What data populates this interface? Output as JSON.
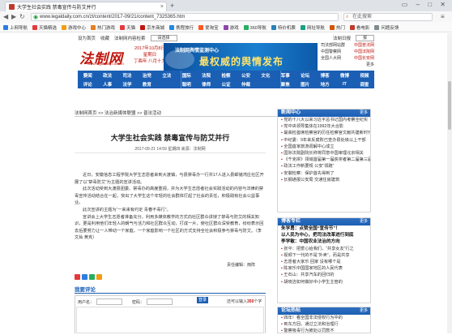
{
  "browser": {
    "tab_title": "大学生社会实践 禁毒宣传与防艾并行",
    "url": "www.legaldaily.com.cn/zt/content/2017-09/21/content_7325365.htm",
    "search_placeholder": "在此搜索",
    "bookmarks": [
      "上网导航",
      "天猫精选",
      "游戏中心",
      "热门游戏",
      "天猫",
      "京东商城",
      "携程旅行",
      "爱淘宝",
      "游戏",
      "360导航",
      "特价机票",
      "网址导航",
      "热门",
      "看电影",
      "问题反馈"
    ]
  },
  "site": {
    "toplinks": [
      "设为首页",
      "收藏",
      "法制网内容检索",
      "法制日报",
      "报"
    ],
    "search_select": "请选择",
    "logo_text": "法制网",
    "logo_url": "www.legaldaily.com.cn",
    "date_lines": [
      "2017年10月8日",
      "星期日",
      "丁酉年 八月十九"
    ],
    "banner_small": "法制网舆情监测中心",
    "banner_big": "最权威的舆情发布",
    "right_links": [
      [
        "司法部网站群",
        "中国普法网"
      ],
      [
        "中国警察网",
        "中国法院网"
      ],
      [
        "全国人大网",
        "中国长安网"
      ],
      [
        "",
        "更多"
      ]
    ],
    "nav_row1": [
      "要闻",
      "政法",
      "司法",
      "治党",
      "立法",
      "",
      "国际",
      "法院",
      "检察",
      "公安",
      "文化",
      "军事",
      "",
      "论坛",
      "博客",
      "微博",
      "视频"
    ],
    "nav_row2": [
      "评论",
      "人事",
      "法学",
      "教育",
      "",
      "",
      "",
      "聪明",
      "律师",
      "公证",
      "仲裁",
      "",
      "",
      "聚焦",
      "图片",
      "地方",
      "IT",
      "调查"
    ]
  },
  "breadcrumb": "法制网首页 >> 法治新媒体联盟 >> 普法活动",
  "article": {
    "title": "大学生社会实践 禁毒宣传与防艾并行",
    "meta": "2017-09-21 14:59 星期四   来源：法制网",
    "paragraphs": [
      "近日，安徽信息工程学院大学生志愿者来到大渡镇，与县禁毒办一行共17人进入县邮储湾庄社区开展了以“禁毒防艾”为主题的宣讲活动。",
      "此次活动受到大渡县团委、禁毒办的高度重视，并为大学生志愿者社会实践活动的内容与法律的禁毒宣传活动结合在一起，突出了大学生这个年轻的社会群体打起了社会的责任，积极践有社会公益事业。",
      "此次宣讲的主题为“一来来有约定 青春不毒行”。",
      "宣讲会上大学生志愿者准备充分，利用多媒体教学的方式向社区群众讲授了禁毒与防艾的相关知识，更是利用他们年轻人的朝气与活力和社区群众互动，打成一片，使社区群众深受教育，纷纷表示回去后要努力让一人带动一个家庭，一个家庭影响一个社区的方式支持全社会积极参与禁毒与防艾。（李文灿 黄克）"
    ],
    "editor": "责任编辑：雨阵"
  },
  "comments": {
    "title": "我要评论",
    "user_label": "用户名：",
    "password_label": "密码：",
    "submit_label": "登录",
    "limit_text_pre": "还可以输入",
    "limit_count": "350",
    "limit_text_post": "个字"
  },
  "sidebar": {
    "news": {
      "title": "新闻中心",
      "more": "更多",
      "items": [
        "党的十八大以来习近平总书记国内考察全纪实",
        "党中央领导集体在1992年大合影",
        "最高检首席检察官的历任检察官文献共建新时代",
        "中纪委：9年来反腐败已查办县处级以上干部",
        "全国首家旅游调解中心成立",
        "国际法院副院长称将同意中国审理北京相关",
        "《千克拼》领域首届第一届获奖者第二届第三届",
        "政法工作新要规 公安“领跑”",
        "安徽检察：保护首先得到了",
        "长钢通报公安局 交通住房建筑"
      ]
    },
    "blog": {
      "title": "博客专栏",
      "more": "更多",
      "headline1": "朱学勇：点赞全国“宣传节”！",
      "headline2": "以人民为中心，把司法改革进行到底",
      "headline3": "李学敏：中国农业法治的方向",
      "items": [
        "张平：把爱心给我们，“共享女友”行之",
        "视频下一代的不是“外卖”，而是共享",
        "志愿者大家乐 回家 没有哪个是",
        "陈家乐中国国家地区的人民代表",
        "王石山：共享汽车的回归的",
        "胡晓洁如何做好中小学生主管的"
      ]
    },
    "forum": {
      "title": "论坛热帖",
      "more": "更多",
      "items": [
        "四年！看全国非法侵权行为中的",
        "到东方回，通过立法和治理行",
        "警察吸毒行为被处以罚款不"
      ]
    }
  }
}
